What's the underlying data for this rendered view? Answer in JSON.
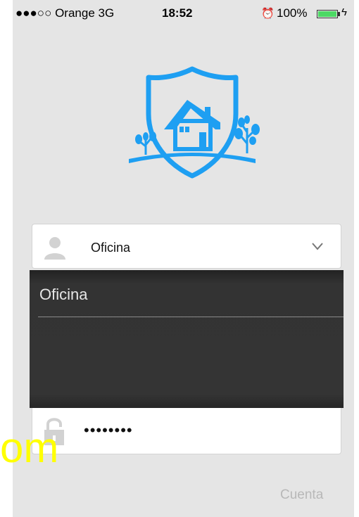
{
  "status_bar": {
    "signal": "●●●○○",
    "carrier": "Orange",
    "network": "3G",
    "time": "18:52",
    "battery": "100%",
    "battery_level": 1.0
  },
  "login": {
    "user_label": "Oficina",
    "password_value": "••••••••"
  },
  "picker": {
    "options": [
      "Oficina"
    ]
  },
  "watermark": "om",
  "footer": {
    "account_link": "Cuenta"
  },
  "colors": {
    "brand_blue": "#1e9ff2",
    "background": "#e5e5e5",
    "watermark": "#ffff00"
  }
}
